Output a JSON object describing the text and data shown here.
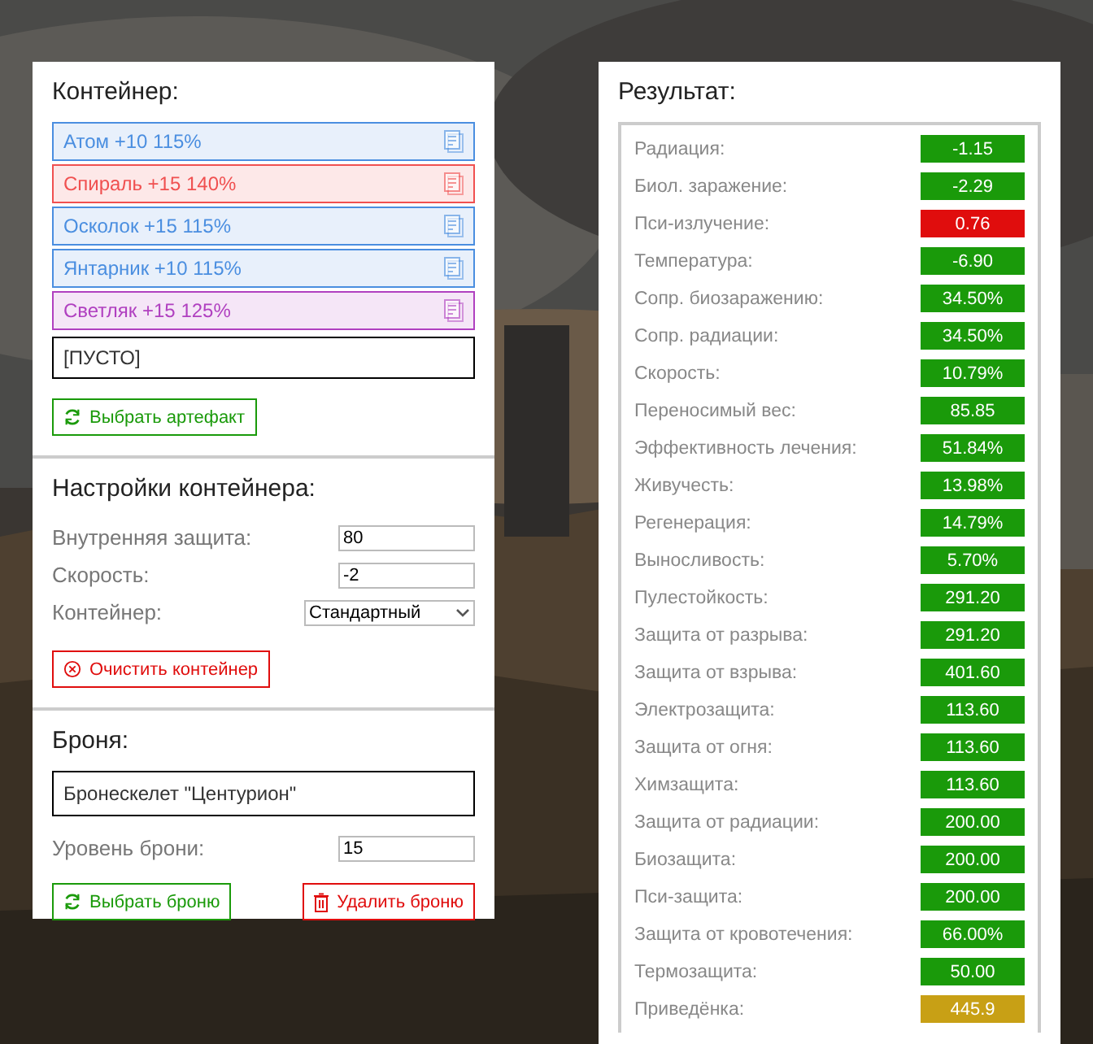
{
  "container": {
    "title": "Контейнер:",
    "slots": [
      {
        "kind": "artifact",
        "label": "Атом +10 115%",
        "color": "#4a8ee0"
      },
      {
        "kind": "artifact",
        "label": "Спираль +15 140%",
        "color": "#f05050"
      },
      {
        "kind": "artifact",
        "label": "Осколок +15 115%",
        "color": "#4a8ee0"
      },
      {
        "kind": "artifact",
        "label": "Янтарник +10 115%",
        "color": "#4a8ee0"
      },
      {
        "kind": "artifact",
        "label": "Светляк +15 125%",
        "color": "#b040c0"
      },
      {
        "kind": "empty",
        "label": "[ПУСТО]"
      }
    ],
    "pick_button": "Выбрать артефакт"
  },
  "settings": {
    "title": "Настройки контейнера:",
    "fields": [
      {
        "kind": "input",
        "label": "Внутренняя защита:",
        "value": "80"
      },
      {
        "kind": "input",
        "label": "Скорость:",
        "value": "-2"
      },
      {
        "kind": "select",
        "label": "Контейнер:",
        "value": "Стандартный"
      }
    ],
    "clear_button": "Очистить контейнер"
  },
  "armor": {
    "title": "Броня:",
    "name": "Бронескелет \"Центурион\"",
    "level_label": "Уровень брони:",
    "level_value": "15",
    "pick_button": "Выбрать броню",
    "delete_button": "Удалить броню"
  },
  "result": {
    "title": "Результат:",
    "rows": [
      {
        "label": "Радиация:",
        "value": "-1.15",
        "color": "#1a9a0a"
      },
      {
        "label": "Биол. заражение:",
        "value": "-2.29",
        "color": "#1a9a0a"
      },
      {
        "label": "Пси-излучение:",
        "value": "0.76",
        "color": "#e00d0d"
      },
      {
        "label": "Температура:",
        "value": "-6.90",
        "color": "#1a9a0a"
      },
      {
        "label": "Сопр. биозаражению:",
        "value": "34.50%",
        "color": "#1a9a0a"
      },
      {
        "label": "Сопр. радиации:",
        "value": "34.50%",
        "color": "#1a9a0a"
      },
      {
        "label": "Скорость:",
        "value": "10.79%",
        "color": "#1a9a0a"
      },
      {
        "label": "Переносимый вес:",
        "value": "85.85",
        "color": "#1a9a0a"
      },
      {
        "label": "Эффективность лечения:",
        "value": "51.84%",
        "color": "#1a9a0a"
      },
      {
        "label": "Живучесть:",
        "value": "13.98%",
        "color": "#1a9a0a"
      },
      {
        "label": "Регенерация:",
        "value": "14.79%",
        "color": "#1a9a0a"
      },
      {
        "label": "Выносливость:",
        "value": "5.70%",
        "color": "#1a9a0a"
      },
      {
        "label": "Пулестойкость:",
        "value": "291.20",
        "color": "#1a9a0a"
      },
      {
        "label": "Защита от разрыва:",
        "value": "291.20",
        "color": "#1a9a0a"
      },
      {
        "label": "Защита от взрыва:",
        "value": "401.60",
        "color": "#1a9a0a"
      },
      {
        "label": "Электрозащита:",
        "value": "113.60",
        "color": "#1a9a0a"
      },
      {
        "label": "Защита от огня:",
        "value": "113.60",
        "color": "#1a9a0a"
      },
      {
        "label": "Химзащита:",
        "value": "113.60",
        "color": "#1a9a0a"
      },
      {
        "label": "Защита от радиации:",
        "value": "200.00",
        "color": "#1a9a0a"
      },
      {
        "label": "Биозащита:",
        "value": "200.00",
        "color": "#1a9a0a"
      },
      {
        "label": "Пси-защита:",
        "value": "200.00",
        "color": "#1a9a0a"
      },
      {
        "label": "Защита от кровотечения:",
        "value": "66.00%",
        "color": "#1a9a0a"
      },
      {
        "label": "Термозащита:",
        "value": "50.00",
        "color": "#1a9a0a"
      },
      {
        "label": "Приведёнка:",
        "value": "445.9",
        "color": "#c8a015"
      }
    ]
  }
}
